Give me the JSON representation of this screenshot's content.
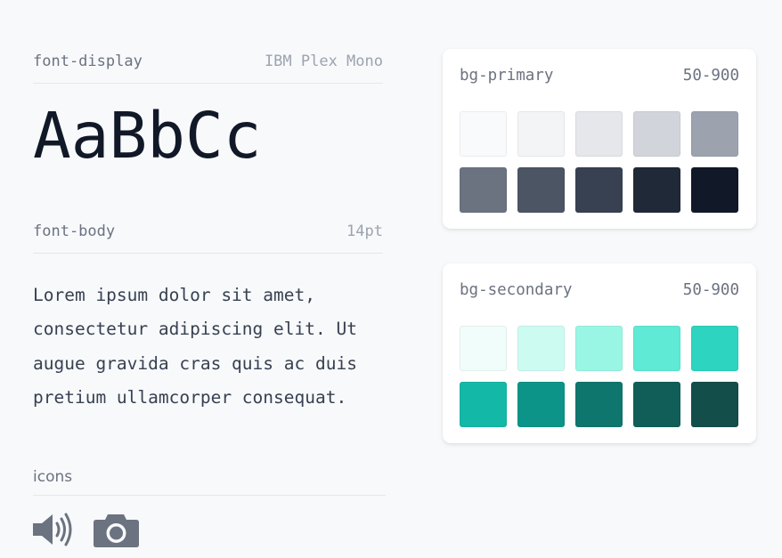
{
  "display": {
    "token": "font-display",
    "family": "IBM Plex Mono",
    "sample": "AaBbCc"
  },
  "body": {
    "token": "font-body",
    "size": "14pt",
    "sample": "Lorem ipsum dolor sit amet, consectetur adipiscing elit. Ut augue gravida cras quis ac duis pretium ullamcorper consequat."
  },
  "icons": {
    "label": "icons",
    "items": [
      "speaker-icon",
      "camera-icon"
    ],
    "color": "#6b7280"
  },
  "palettes": [
    {
      "name": "bg-primary",
      "range": "50-900",
      "colors": [
        "#f9fafb",
        "#f3f4f6",
        "#e5e7eb",
        "#d1d5db",
        "#9ca3af",
        "#6b7280",
        "#4b5563",
        "#374151",
        "#1f2937",
        "#111827"
      ]
    },
    {
      "name": "bg-secondary",
      "range": "50-900",
      "colors": [
        "#f0fdfa",
        "#ccfbf1",
        "#99f6e4",
        "#5eead4",
        "#2dd4bf",
        "#14b8a6",
        "#0d9488",
        "#0f766e",
        "#115e59",
        "#134e4a"
      ]
    }
  ]
}
